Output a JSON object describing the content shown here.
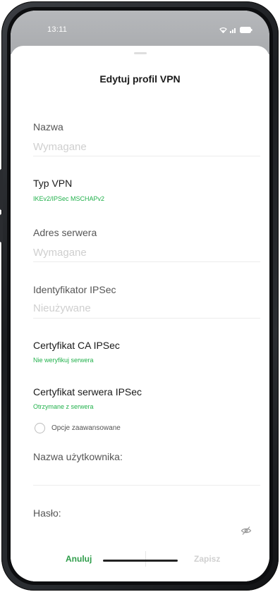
{
  "status_bar": {
    "time": "13:11",
    "icons": [
      "wifi-icon",
      "signal-icon",
      "battery-icon"
    ]
  },
  "dialog": {
    "title": "Edytuj profil VPN",
    "fields": {
      "name": {
        "label": "Nazwa",
        "placeholder": "Wymagane"
      },
      "server_address": {
        "label": "Adres serwera",
        "placeholder": "Wymagane"
      },
      "ipsec_identifier": {
        "label": "Identyfikator IPSec",
        "placeholder": "Nieużywane"
      },
      "username": {
        "label": "Nazwa użytkownika:",
        "value": ""
      },
      "password": {
        "label": "Hasło:",
        "value": ""
      }
    },
    "prefs": {
      "vpn_type": {
        "title": "Typ VPN",
        "value": "IKEv2/IPSec MSCHAPv2"
      },
      "ca_certificate": {
        "title": "Certyfikat CA IPSec",
        "value": "Nie weryfikuj serwera"
      },
      "server_certificate": {
        "title": "Certyfikat serwera IPSec",
        "value": "Otrzymane z serwera"
      }
    },
    "advanced_options": {
      "label": "Opcje zaawansowane",
      "checked": false
    },
    "buttons": {
      "cancel": "Anuluj",
      "save": "Zapisz"
    }
  },
  "colors": {
    "accent_green": "#22b14c",
    "cancel_green": "#2e9d4a",
    "disabled_gray": "#d0d0d0"
  }
}
